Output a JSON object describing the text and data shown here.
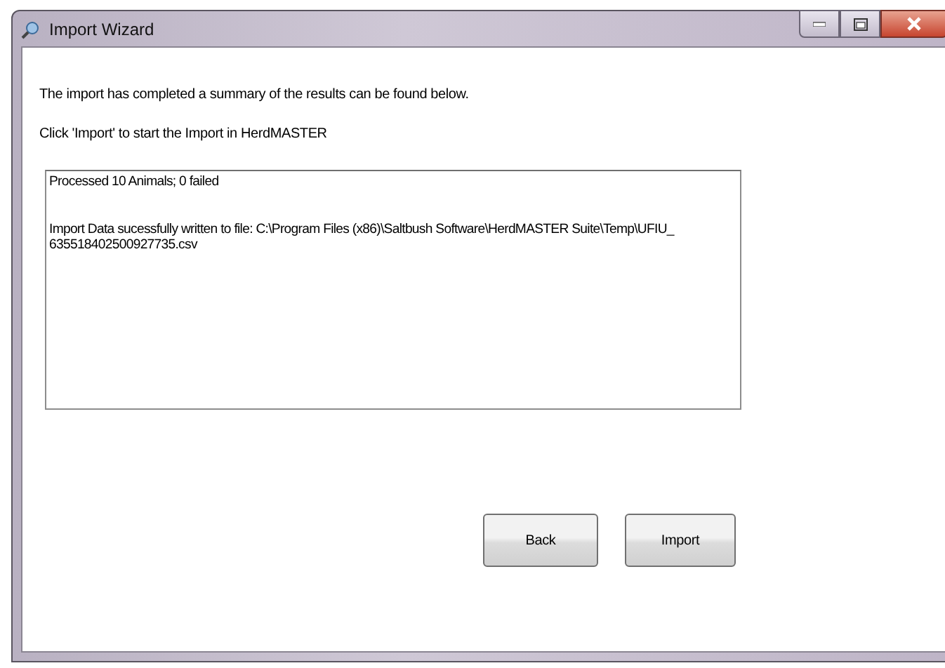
{
  "window": {
    "title": "Import Wizard"
  },
  "messages": [
    "The import has completed a summary of the results can be found below.",
    "Click 'Import' to start the Import in HerdMASTER"
  ],
  "results": {
    "paragraphs": [
      {
        "lines": [
          "Processed 10 Animals; 0 failed"
        ]
      },
      {
        "lines": [
          "Import Data sucessfully written to file: C:\\Program Files (x86)\\Saltbush Software\\HerdMASTER Suite\\Temp\\UFIU_",
          "635518402500927735.csv"
        ]
      }
    ]
  },
  "buttons": [
    {
      "label": "Back"
    },
    {
      "label": "Import"
    }
  ]
}
